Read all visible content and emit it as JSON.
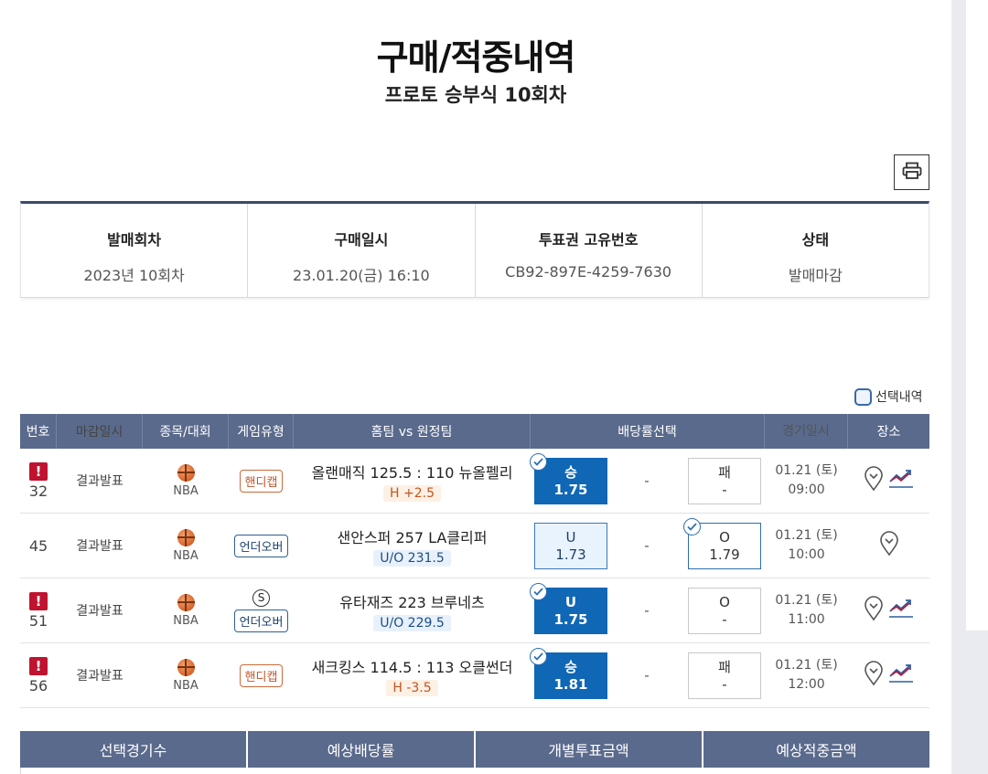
{
  "header": {
    "title": "구매/적중내역",
    "subtitle": "프로토 승부식 10회차"
  },
  "info": {
    "columns": [
      {
        "label": "발매회차",
        "value": "2023년 10회차"
      },
      {
        "label": "구매일시",
        "value": "23.01.20(금) 16:10"
      },
      {
        "label": "투표권 고유번호",
        "value": "CB92-897E-4259-7630"
      },
      {
        "label": "상태",
        "value": "발매마감"
      }
    ]
  },
  "select_history_label": "선택내역",
  "bet_table": {
    "headers": {
      "no": "번호",
      "close": "마감일시",
      "sport": "종목/대회",
      "type": "게임유형",
      "teams": "홈팀 vs 원정팀",
      "odds": "배당률선택",
      "time": "경기일시",
      "place": "장소"
    },
    "rows": [
      {
        "no": "32",
        "alert": "!",
        "close": "결과발표",
        "sport": "NBA",
        "type": "핸디캡",
        "match": "올랜매직 125.5 : 110 뉴올펠리",
        "line": "H +2.5",
        "left": {
          "label": "승",
          "odds": "1.75"
        },
        "draw": "-",
        "right": {
          "label": "패",
          "odds": "-"
        },
        "date": "01.21 (토)",
        "time": "09:00"
      },
      {
        "no": "45",
        "close": "결과발표",
        "sport": "NBA",
        "type": "언더오버",
        "match": "샌안스퍼  257  LA클리퍼",
        "line": "U/O 231.5",
        "left": {
          "label": "U",
          "odds": "1.73"
        },
        "draw": "-",
        "right": {
          "label": "O",
          "odds": "1.79"
        },
        "date": "01.21 (토)",
        "time": "10:00"
      },
      {
        "no": "51",
        "alert": "!",
        "close": "결과발표",
        "sport": "NBA",
        "special": "S",
        "type": "언더오버",
        "match": "유타재즈  223  브루네츠",
        "line": "U/O 229.5",
        "left": {
          "label": "U",
          "odds": "1.75"
        },
        "draw": "-",
        "right": {
          "label": "O",
          "odds": "-"
        },
        "date": "01.21 (토)",
        "time": "11:00"
      },
      {
        "no": "56",
        "alert": "!",
        "close": "결과발표",
        "sport": "NBA",
        "type": "핸디캡",
        "match": "새크킹스 114.5 : 113 오클썬더",
        "line": "H -3.5",
        "left": {
          "label": "승",
          "odds": "1.81"
        },
        "draw": "-",
        "right": {
          "label": "패",
          "odds": "-"
        },
        "date": "01.21 (토)",
        "time": "12:00"
      }
    ]
  },
  "summary": {
    "headers": [
      "선택경기수",
      "예상배당률",
      "개별투표금액",
      "예상적중금액"
    ]
  },
  "colors": {
    "header_bg": "#5a6a8c",
    "selected_blue": "#0f67b6",
    "alert_red": "#c0132f",
    "handicap_orange": "#c0552a",
    "underover_blue": "#1d3f6e"
  }
}
